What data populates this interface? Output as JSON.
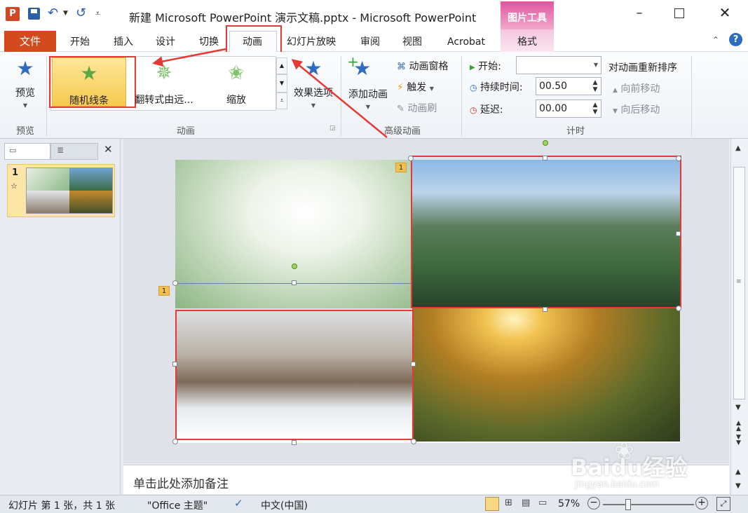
{
  "title": "新建 Microsoft PowerPoint 演示文稿.pptx - Microsoft PowerPoint",
  "contextual_tab": {
    "group": "图片工具",
    "tab": "格式"
  },
  "tabs": {
    "file": "文件",
    "home": "开始",
    "insert": "插入",
    "design": "设计",
    "transitions": "切换",
    "animations": "动画",
    "slideshow": "幻灯片放映",
    "review": "审阅",
    "view": "视图",
    "acrobat": "Acrobat"
  },
  "ribbon": {
    "preview": {
      "button": "预览",
      "group": "预览"
    },
    "animation_gallery": {
      "items": [
        "随机线条",
        "翻转式由远...",
        "缩放"
      ],
      "group": "动画"
    },
    "effect_options": "效果选项",
    "advanced": {
      "add_animation": "添加动画",
      "animation_pane": "动画窗格",
      "trigger": "触发",
      "animation_painter": "动画刷",
      "group": "高级动画"
    },
    "timing": {
      "start_label": "开始:",
      "start_value": "",
      "duration_label": "持续时间:",
      "duration_value": "00.50",
      "delay_label": "延迟:",
      "delay_value": "00.00",
      "reorder_title": "对动画重新排序",
      "move_earlier": "向前移动",
      "move_later": "向后移动",
      "group": "计时"
    }
  },
  "left_pane": {
    "slide_number": "1",
    "slide_star": "☆"
  },
  "slide": {
    "anim_tag_1": "1",
    "anim_tag_2": "1"
  },
  "notes_placeholder": "单击此处添加备注",
  "status": {
    "slide_info": "幻灯片 第 1 张，共 1 张",
    "theme": "\"Office 主题\"",
    "language": "中文(中国)",
    "zoom": "57%"
  },
  "watermark": {
    "brand": "Baidu经验",
    "url": "jingyan.baidu.com"
  },
  "colors": {
    "accent_orange": "#e96a2c",
    "highlight_red": "#e53935",
    "contextual_pink": "#d43a91",
    "gallery_selected": "#f8d86a"
  }
}
